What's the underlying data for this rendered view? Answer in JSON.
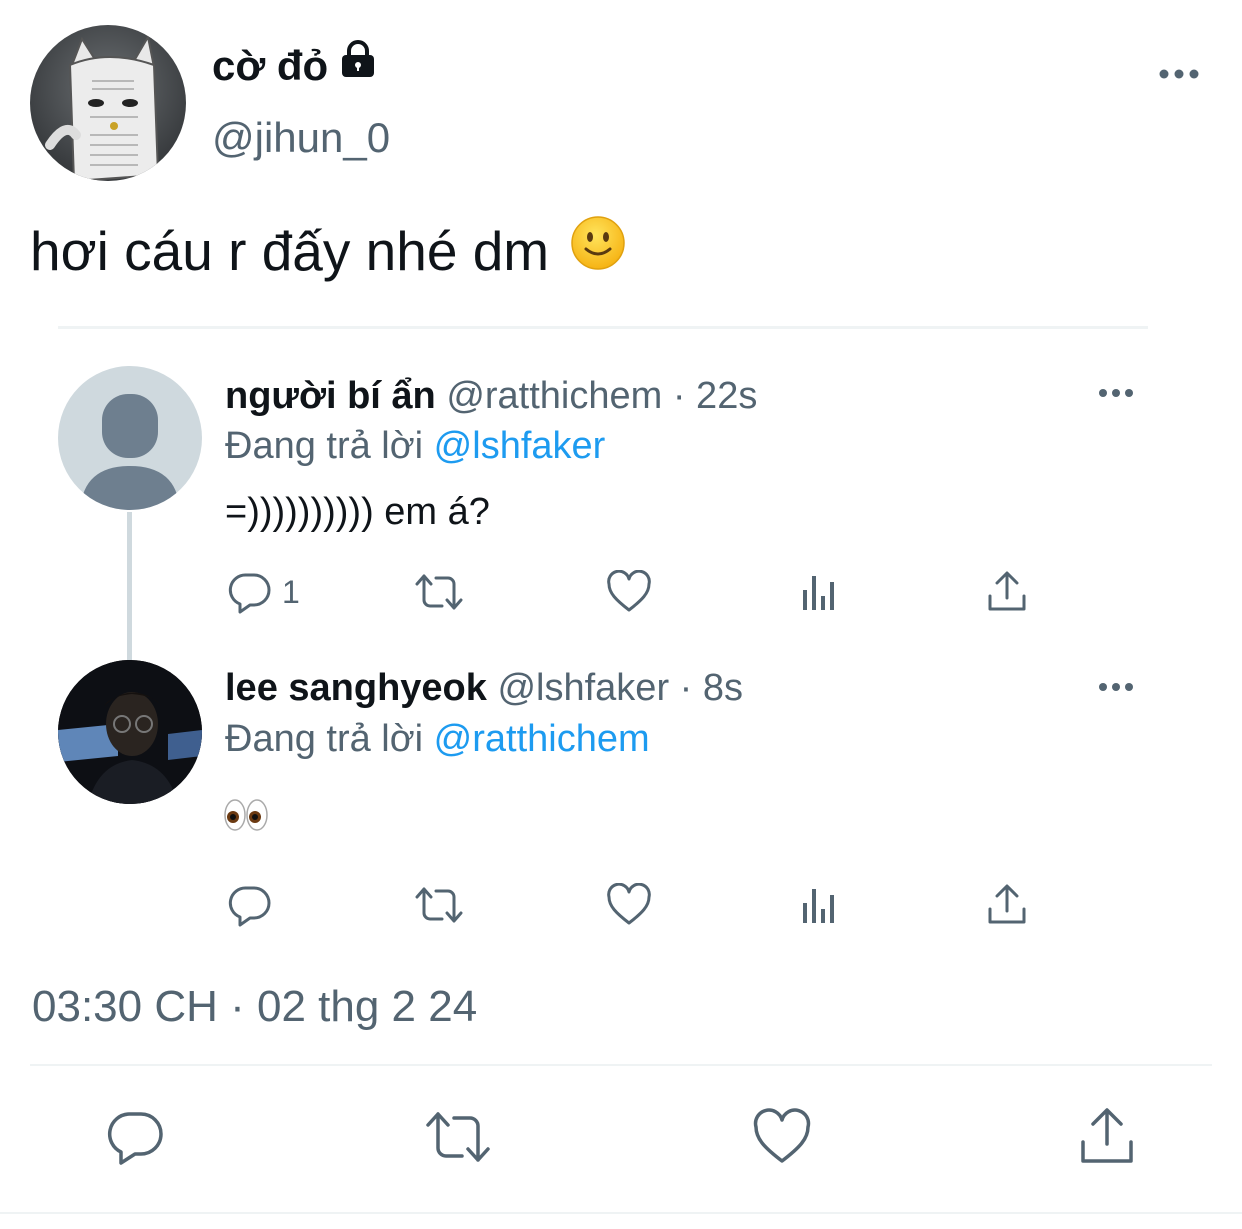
{
  "main_tweet": {
    "display_name": "cờ đỏ",
    "handle": "@jihun_0",
    "text": "hơi cáu r đấy nhé dm",
    "timestamp": "03:30 CH · 02 thg 2 24"
  },
  "replies": [
    {
      "display_name": "người bí ẩn",
      "meta": "@ratthichem · 22s",
      "replying_label": "Đang trả lời",
      "replying_to": "@lshfaker",
      "text": "=)))))))))) em á?",
      "reply_count": "1"
    },
    {
      "display_name": "lee sanghyeok",
      "meta": "@lshfaker · 8s",
      "replying_label": "Đang trả lời",
      "replying_to": "@ratthichem",
      "text": "👀",
      "reply_count": ""
    }
  ],
  "icons": [
    "lock-icon",
    "more-icon",
    "smile-emoji-icon",
    "reply-icon",
    "retweet-icon",
    "like-icon",
    "views-icon",
    "share-icon",
    "eyes-emoji-icon"
  ],
  "colors": {
    "text": "#0f1419",
    "secondary": "#536471",
    "link": "#1d9bf0",
    "divider": "#eff3f4"
  }
}
